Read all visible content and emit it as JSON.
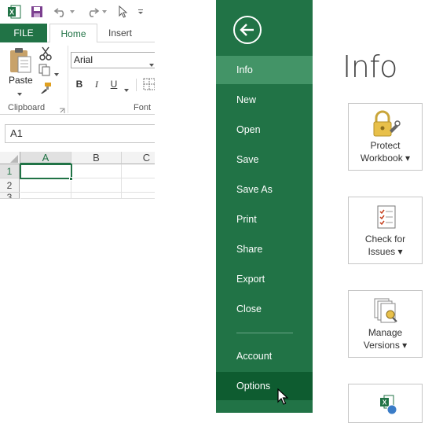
{
  "excel": {
    "tabs": [
      {
        "label": "FILE"
      },
      {
        "label": "Home"
      },
      {
        "label": "Insert"
      }
    ],
    "clipboard": {
      "paste_label": "Paste",
      "group_label": "Clipboard"
    },
    "font": {
      "name": "Arial",
      "group_label": "Font",
      "bold": "B",
      "italic": "I",
      "underline": "U"
    },
    "name_box": "A1",
    "columns": [
      "A",
      "B",
      "C"
    ],
    "rows": [
      "1",
      "2",
      "3"
    ]
  },
  "backstage": {
    "nav": [
      {
        "label": "Info"
      },
      {
        "label": "New"
      },
      {
        "label": "Open"
      },
      {
        "label": "Save"
      },
      {
        "label": "Save As"
      },
      {
        "label": "Print"
      },
      {
        "label": "Share"
      },
      {
        "label": "Export"
      },
      {
        "label": "Close"
      },
      {
        "label": "Account"
      },
      {
        "label": "Options"
      }
    ],
    "title": "Info",
    "tiles": [
      {
        "line1": "Protect",
        "line2": "Workbook ▾"
      },
      {
        "line1": "Check for",
        "line2": "Issues ▾"
      },
      {
        "line1": "Manage",
        "line2": "Versions ▾"
      }
    ]
  },
  "colors": {
    "excel_green": "#217346",
    "nav_active": "#439467",
    "nav_hover": "#0e5c30"
  }
}
